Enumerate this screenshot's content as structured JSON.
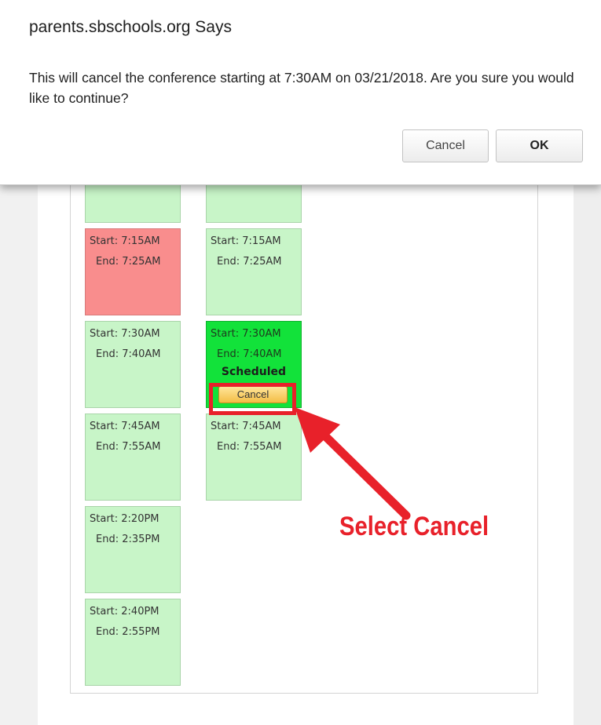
{
  "dialog": {
    "title": "parents.sbschools.org Says",
    "message": "This will cancel the conference starting at 7:30AM on 03/21/2018.  Are you sure you would like to continue?",
    "cancel_label": "Cancel",
    "ok_label": "OK"
  },
  "schedule": {
    "column_1": [
      {
        "start": "Start:  7:15AM",
        "end": "End:  7:25AM",
        "state": "booked"
      },
      {
        "start": "Start:  7:30AM",
        "end": "End:  7:40AM",
        "state": "available"
      },
      {
        "start": "Start:  7:45AM",
        "end": "End:  7:55AM",
        "state": "available"
      },
      {
        "start": "Start:  2:20PM",
        "end": "End:  2:35PM",
        "state": "available"
      },
      {
        "start": "Start:  2:40PM",
        "end": "End:  2:55PM",
        "state": "available"
      }
    ],
    "column_2": [
      {
        "start": "Start:  7:15AM",
        "end": "End:  7:25AM",
        "state": "available"
      },
      {
        "start": "Start:  7:30AM",
        "end": "End:  7:40AM",
        "state": "scheduled",
        "status": "Scheduled",
        "action_label": "Cancel"
      },
      {
        "start": "Start:  7:45AM",
        "end": "End:  7:55AM",
        "state": "available"
      }
    ]
  },
  "annotation": {
    "label": "Select Cancel",
    "color": "#e8212a"
  },
  "colors": {
    "available": "#c8f5c8",
    "booked": "#f98d8d",
    "scheduled": "#12e23a",
    "cancel_button": "#f3bd45"
  }
}
